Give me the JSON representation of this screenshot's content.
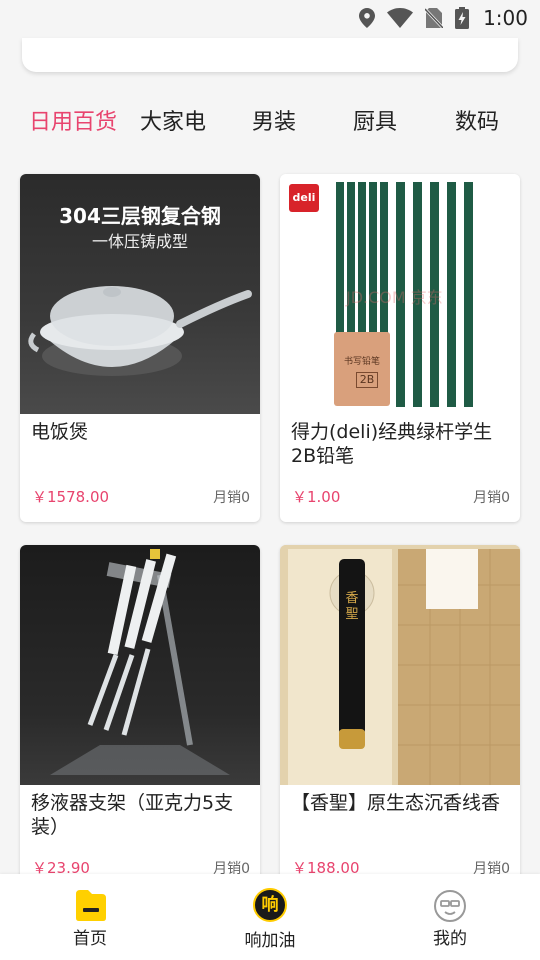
{
  "status_bar": {
    "time": "1:00",
    "icons": [
      "location-icon",
      "wifi-icon",
      "no-sim-icon",
      "battery-charging-icon"
    ]
  },
  "categories": {
    "tabs": [
      {
        "label": "日用百货",
        "active": true
      },
      {
        "label": "大家电",
        "active": false
      },
      {
        "label": "男装",
        "active": false
      },
      {
        "label": "厨具",
        "active": false
      },
      {
        "label": "数码",
        "active": false
      }
    ]
  },
  "products": [
    {
      "title": "电饭煲",
      "price": "￥1578.00",
      "sales": "月销0",
      "image_text": {
        "line1": "304三层钢复合钢",
        "line2": "一体压铸成型"
      }
    },
    {
      "title": "得力(deli)经典绿杆学生2B铅笔",
      "price": "￥1.00",
      "sales": "月销0",
      "image_text": {
        "brand": "deli",
        "watermark": "JD.COM 京东",
        "box_label": "书写铅笔",
        "grade": "2B"
      }
    },
    {
      "title": "移液器支架（亚克力5支装）",
      "price": "￥23.90",
      "sales": "月销0"
    },
    {
      "title": "【香聖】原生态沉香线香",
      "price": "￥188.00",
      "sales": "月销0",
      "image_text": {
        "brand": "香聖"
      }
    }
  ],
  "bottom_nav": {
    "items": [
      {
        "label": "首页",
        "icon": "home-icon"
      },
      {
        "label": "响加油",
        "icon": "fuel-brand-icon",
        "icon_text": "响"
      },
      {
        "label": "我的",
        "icon": "profile-icon"
      }
    ]
  },
  "colors": {
    "accent": "#e8446e",
    "background": "#f5f5f5",
    "nav_home": "#ffd000"
  }
}
